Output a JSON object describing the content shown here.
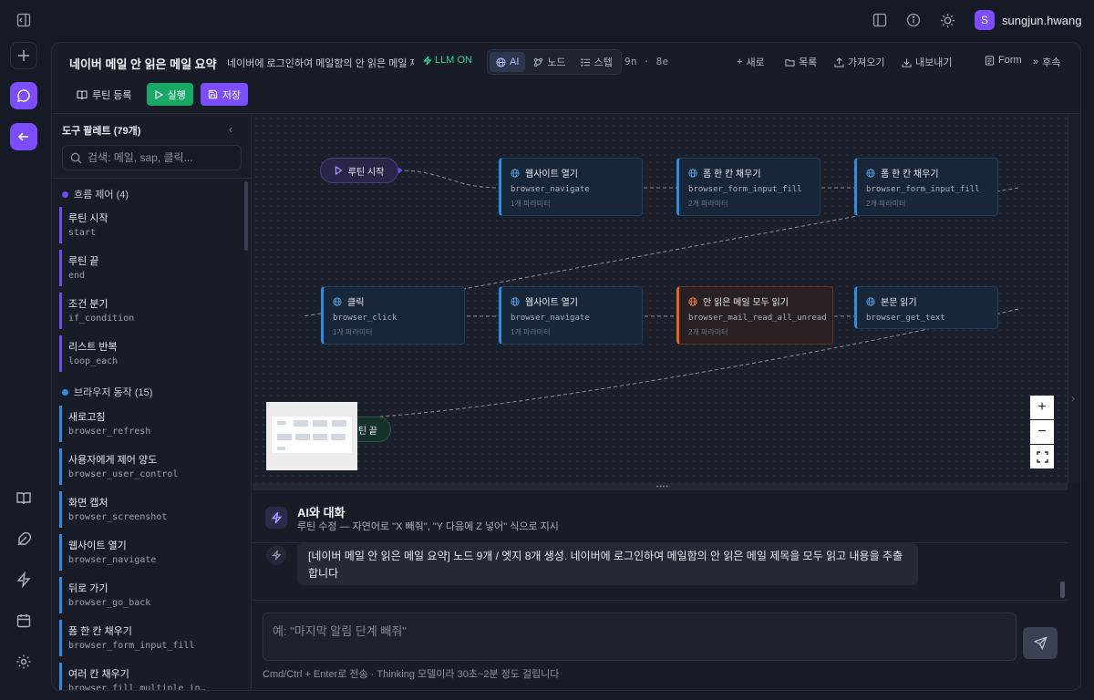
{
  "user": {
    "initial": "S",
    "name": "sungjun.hwang"
  },
  "header": {
    "title": "네이버 메일 안 읽은 메일 요약",
    "description": "네이버에 로그인하여 메일함의 안 읽은 메일 제",
    "llm_label": "LLM ON",
    "view_tabs": [
      {
        "label": "AI",
        "icon": "globe-icon",
        "active": true
      },
      {
        "label": "노드",
        "icon": "node-icon",
        "active": false
      },
      {
        "label": "스텝",
        "icon": "list-icon",
        "active": false
      }
    ],
    "counts": "9n · 8e",
    "toolbar": {
      "new": "새로",
      "list": "목록",
      "import": "가져오기",
      "export": "내보내기",
      "form": "Form",
      "more": "후속"
    },
    "actions": {
      "register": "루틴 등록",
      "run": "실행",
      "save": "저장"
    }
  },
  "palette": {
    "title": "도구 팔레트 (79개)",
    "search_placeholder": "검색: 메일, sap, 클릭...",
    "categories": [
      {
        "label": "흐름 제어 (4)",
        "color": "#6b4df2"
      },
      {
        "label": "브라우저 동작 (15)",
        "color": "#2c8de3"
      }
    ],
    "flow_items": [
      {
        "name": "루틴 시작",
        "code": "start"
      },
      {
        "name": "루틴 끝",
        "code": "end"
      },
      {
        "name": "조건 분기",
        "code": "if_condition"
      },
      {
        "name": "리스트 반복",
        "code": "loop_each"
      }
    ],
    "browser_items": [
      {
        "name": "새로고침",
        "code": "browser_refresh"
      },
      {
        "name": "사용자에게 제어 양도",
        "code": "browser_user_control"
      },
      {
        "name": "화면 캡처",
        "code": "browser_screenshot"
      },
      {
        "name": "웹사이트 열기",
        "code": "browser_navigate"
      },
      {
        "name": "뒤로 가기",
        "code": "browser_go_back"
      },
      {
        "name": "폼 한 칸 채우기",
        "code": "browser_form_input_fill"
      },
      {
        "name": "여러 칸 채우기",
        "code": "browser_fill_multiple_in…"
      }
    ]
  },
  "flow": {
    "start_label": "루틴 시작",
    "end_label": "루틴 끝",
    "end_visible_label": "틴 끝",
    "nodes": [
      {
        "title": "웹사이트 열기",
        "func": "browser_navigate",
        "params": "1개 파라미터"
      },
      {
        "title": "폼 한 칸 채우기",
        "func": "browser_form_input_fill",
        "params": "2개 파라미터"
      },
      {
        "title": "폼 한 칸 채우기",
        "func": "browser_form_input_fill",
        "params": "2개 파라미터"
      },
      {
        "title": "클릭",
        "func": "browser_click",
        "params": "1개 파라미터"
      },
      {
        "title": "웹사이트 열기",
        "func": "browser_navigate",
        "params": "1개 파라미터"
      },
      {
        "title": "안 읽은 메일 모두 읽기",
        "func": "browser_mail_read_all_unread",
        "params": "2개 파라미터"
      },
      {
        "title": "본문 읽기",
        "func": "browser_get_text",
        "params": ""
      }
    ],
    "zoom_in": "+",
    "zoom_out": "−"
  },
  "chat": {
    "title": "AI와 대화",
    "subtitle": "루틴 수정 — 자연어로 \"X 빼줘\", \"Y 다음에 Z 넣어\" 식으로 지시",
    "message": "[네이버 메일 안 읽은 메일 요약] 노드 9개 / 엣지 8개 생성. 네이버에 로그인하여 메일함의 안 읽은 메일 제목을 모두 읽고 내용을 추출합니다",
    "input_placeholder": "예: \"마지막 알림 단계 빼줘\"",
    "hint": "Cmd/Ctrl + Enter로 전송 · Thinking 모델이라 30초~2분 정도 걸립니다"
  }
}
